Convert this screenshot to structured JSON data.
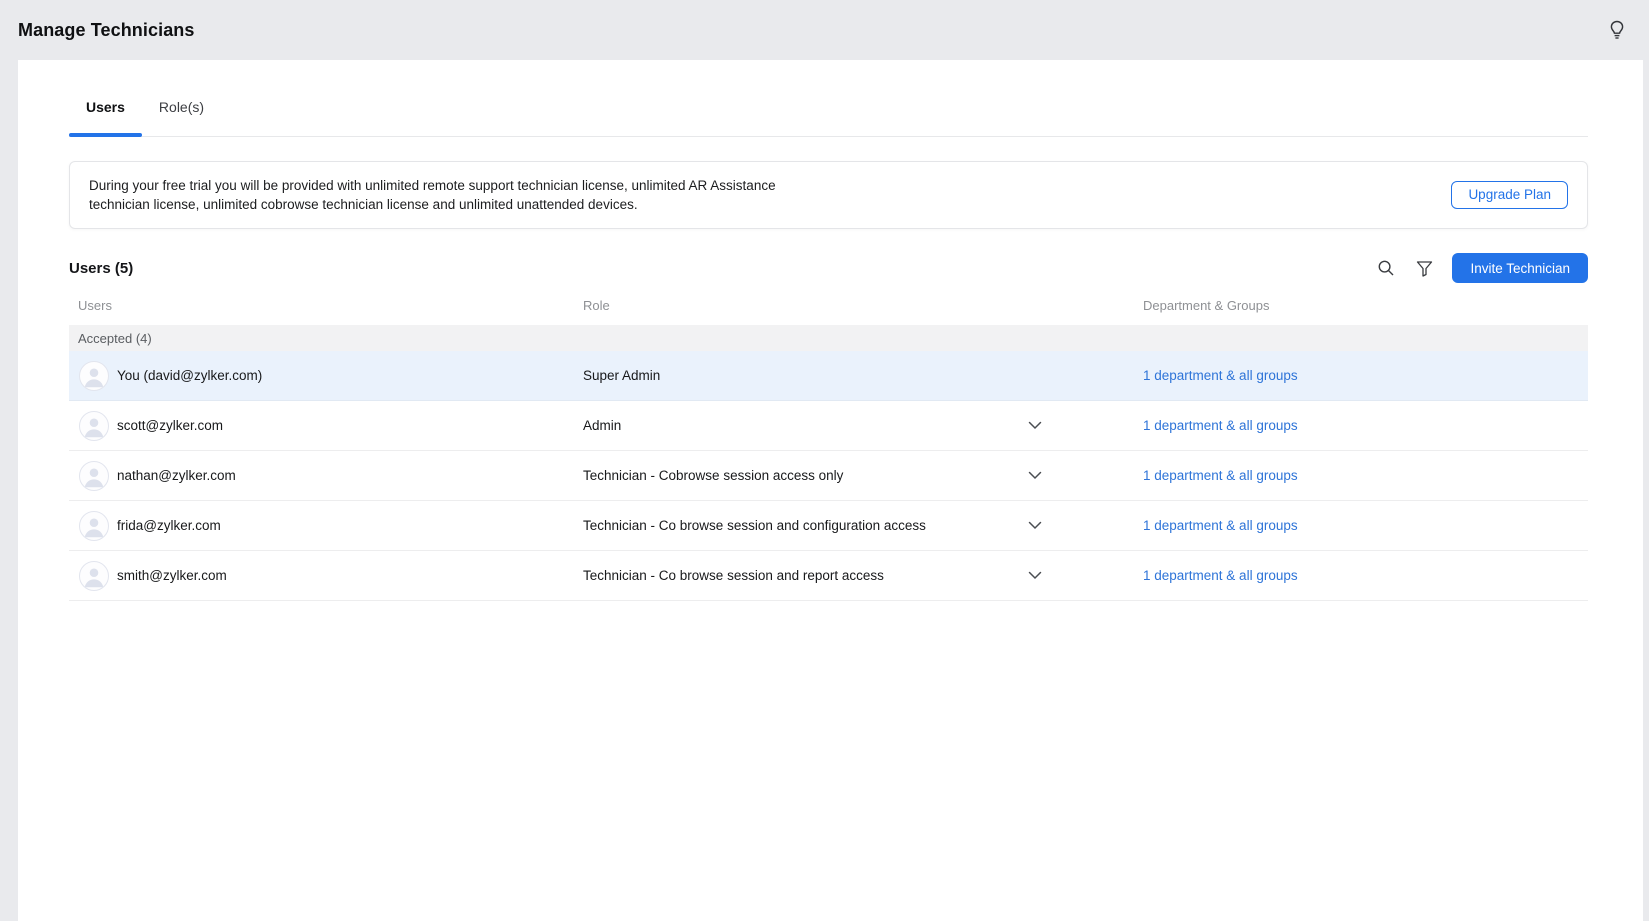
{
  "colors": {
    "accent": "#2373e8",
    "link": "#2e74d8",
    "page_bg": "#e9eaed",
    "highlight_row": "#eaf2fc"
  },
  "header": {
    "title": "Manage Technicians"
  },
  "tabs": [
    {
      "label": "Users",
      "active": true
    },
    {
      "label": "Role(s)",
      "active": false
    }
  ],
  "trial_banner": {
    "text": "During your free trial you will be provided with unlimited remote support technician license, unlimited AR Assistance technician license, unlimited cobrowse technician license and unlimited unattended devices.",
    "button_label": "Upgrade Plan"
  },
  "users_section": {
    "title": "Users (5)",
    "invite_button_label": "Invite Technician",
    "columns": {
      "users": "Users",
      "role": "Role",
      "dept": "Department & Groups"
    },
    "group_header": "Accepted (4)",
    "rows": [
      {
        "name": "You (david@zylker.com)",
        "role": "Super Admin",
        "dept": "1 department & all groups",
        "expandable": false,
        "highlighted": true
      },
      {
        "name": "scott@zylker.com",
        "role": "Admin",
        "dept": "1 department & all groups",
        "expandable": true,
        "highlighted": false
      },
      {
        "name": "nathan@zylker.com",
        "role": "Technician - Cobrowse session access only",
        "dept": "1 department & all groups",
        "expandable": true,
        "highlighted": false
      },
      {
        "name": "frida@zylker.com",
        "role": "Technician - Co browse session and configuration access",
        "dept": "1 department & all groups",
        "expandable": true,
        "highlighted": false
      },
      {
        "name": "smith@zylker.com",
        "role": "Technician - Co browse session and report access",
        "dept": "1 department & all groups",
        "expandable": true,
        "highlighted": false
      }
    ]
  }
}
